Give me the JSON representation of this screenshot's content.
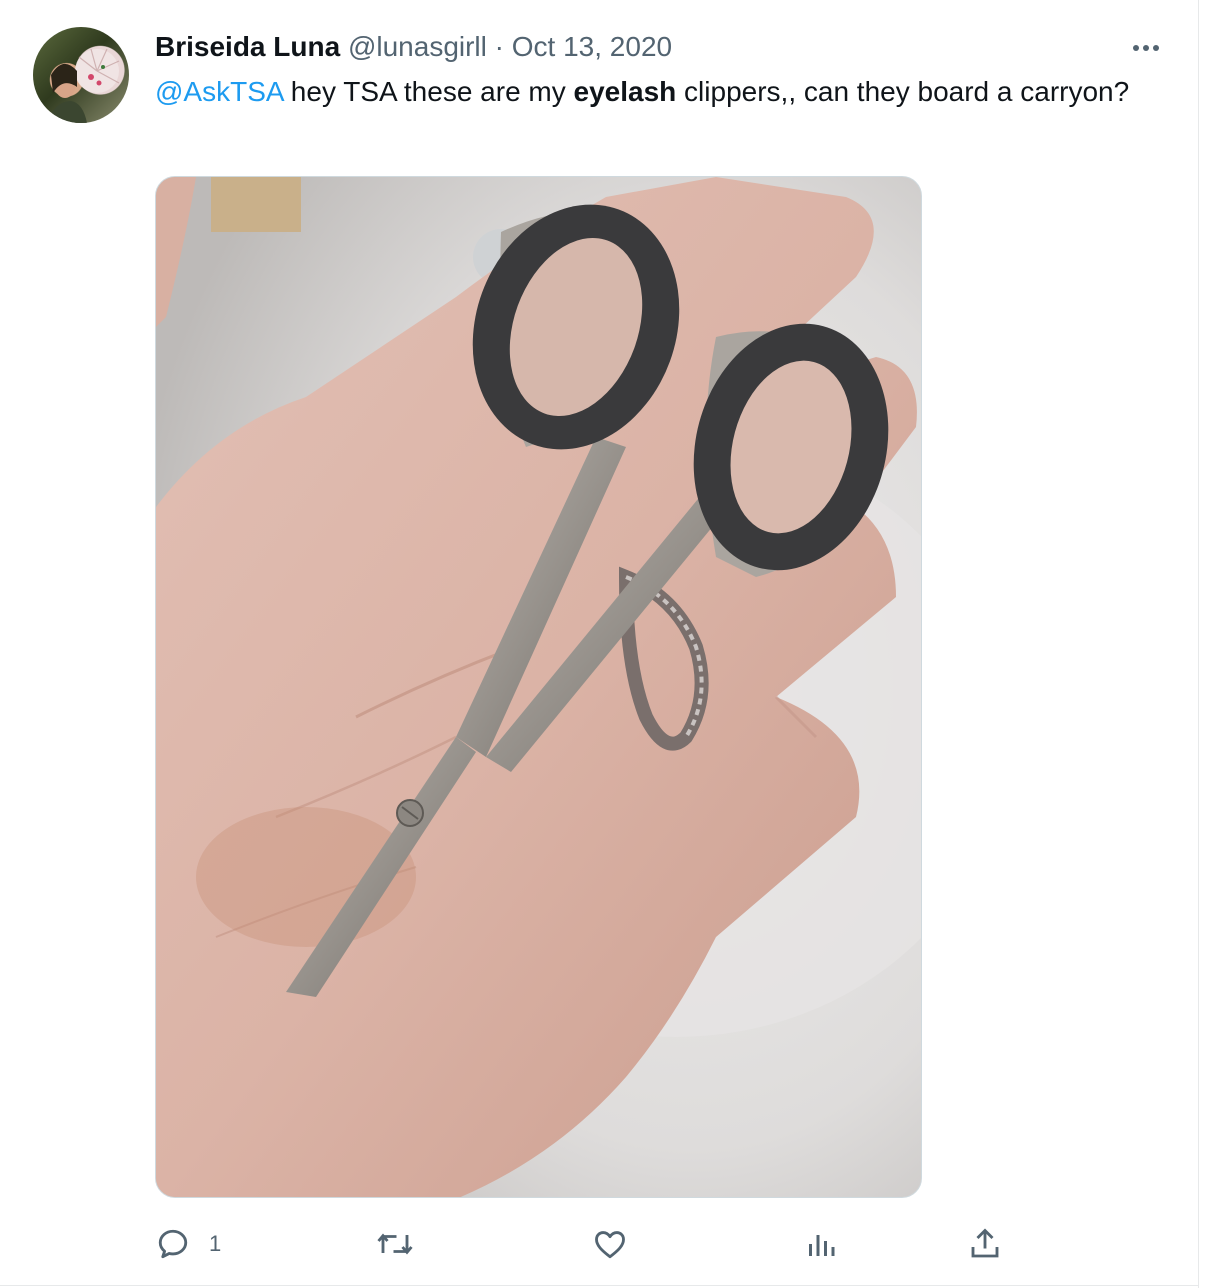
{
  "tweet": {
    "author_name": "Briseida Luna",
    "handle": "@lunasgirll",
    "separator": "·",
    "date": "Oct 13, 2020",
    "text": {
      "mention": "@AskTSA",
      "part1": " hey TSA these are my ",
      "bold": "eyelash",
      "part2": " clippers,, can they board a carryon?"
    }
  },
  "actions": {
    "reply_count": "1"
  },
  "icons": {
    "more": "more-dots-icon",
    "reply": "reply-icon",
    "retweet": "retweet-icon",
    "like": "heart-icon",
    "views": "views-icon",
    "share": "share-icon"
  },
  "colors": {
    "link": "#1d9bf0",
    "secondary_text": "#536471",
    "primary_text": "#0f1419",
    "border": "#cfd9de"
  }
}
